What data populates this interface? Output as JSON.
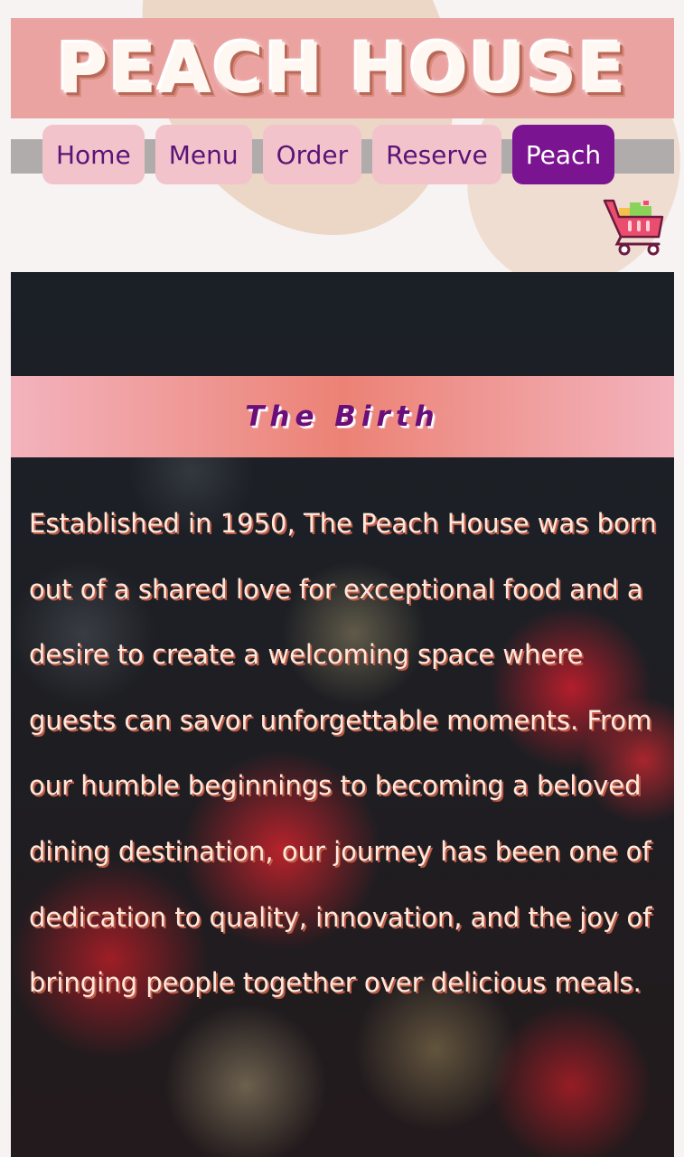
{
  "header": {
    "title": "PEACH HOUSE"
  },
  "nav": {
    "items": [
      {
        "label": "Home",
        "name": "nav-home"
      },
      {
        "label": "Menu",
        "name": "nav-menu"
      },
      {
        "label": "Order",
        "name": "nav-order"
      },
      {
        "label": "Reserve",
        "name": "nav-reserve"
      },
      {
        "label": "Peach",
        "name": "nav-peach"
      }
    ],
    "active": "Peach"
  },
  "cart": {
    "icon": "shopping-cart-icon"
  },
  "section": {
    "heading": "The Birth",
    "body": "Established in 1950, The Peach House was born out of a shared love for exceptional food and a desire to create a welcoming space where guests can savor unforgettable moments. From our humble beginnings to becoming a beloved dining destination, our journey has been one of dedication to quality, innovation, and the joy of bringing people together over delicious meals."
  },
  "colors": {
    "banner": "#eaa3a1",
    "nav_item": "#f3c3cc",
    "nav_active": "#7a1490",
    "nav_text": "#5b1477",
    "heading_text": "#6a0f7a"
  }
}
